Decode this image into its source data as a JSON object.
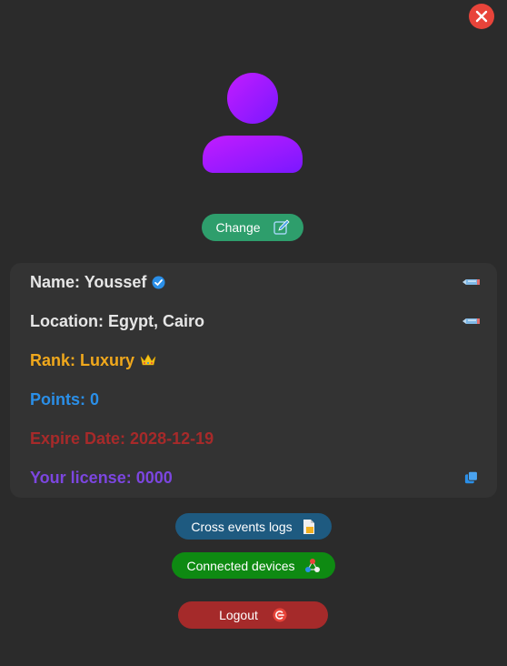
{
  "header": {
    "close_icon": "close-icon"
  },
  "profile": {
    "avatar_icon": "user-avatar-icon",
    "change_label": "Change",
    "change_icon": "edit-icon"
  },
  "info": {
    "name_label": "Name: Youssef",
    "name_badge_icon": "verified-badge-icon",
    "location_label": "Location: Egypt, Cairo",
    "rank_label": "Rank: Luxury",
    "rank_icon": "crown-icon",
    "points_label": "Points: 0",
    "expire_label": "Expire Date: 2028-12-19",
    "license_label": "Your license: 0000",
    "license_action_icon": "copy-icon",
    "edit_icon": "pencil-icon"
  },
  "actions": {
    "logs_label": "Cross events logs",
    "logs_icon": "document-icon",
    "devices_label": "Connected devices",
    "devices_icon": "network-icon",
    "logout_label": "Logout",
    "logout_icon": "logout-icon"
  },
  "colors": {
    "background": "#2b2b2b",
    "card": "#333333",
    "close": "#e8443a",
    "avatar_gradient_start": "#c21cff",
    "avatar_gradient_end": "#7a18ff",
    "change_button": "#2e9e6c",
    "name_text": "#e6e6e6",
    "rank_text": "#f0a81c",
    "points_text": "#2a8fe8",
    "expire_text": "#a72a2a",
    "license_text": "#7c46e0",
    "logs_button": "#1e5a80",
    "devices_button": "#0e8a12",
    "logout_button": "#a52a2a"
  }
}
